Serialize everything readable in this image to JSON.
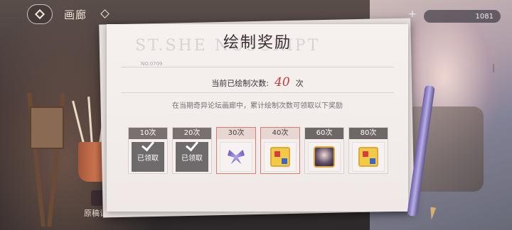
{
  "header": {
    "title": "画廊"
  },
  "currency": {
    "plus": "+",
    "amount": "1081"
  },
  "modal": {
    "title": "绘制奖励",
    "watermark": "ST.SHE    NUSCRIPT",
    "paper_no": "NO.0709",
    "count_label": "当前已绘制次数:",
    "count_value": "40",
    "count_unit": "次",
    "description": "在当期奇异论坛画廊中，累计绘制次数可领取以下奖励"
  },
  "rewards": [
    {
      "label": "10次",
      "state": "claimed",
      "status_text": "已领取",
      "icon": "brush-icon"
    },
    {
      "label": "20次",
      "state": "claimed",
      "status_text": "已领取",
      "icon": "brush-icon"
    },
    {
      "label": "30次",
      "state": "available",
      "icon": "butterfly-icon"
    },
    {
      "label": "40次",
      "state": "available",
      "icon": "palette-icon"
    },
    {
      "label": "60次",
      "state": "locked",
      "icon": "portrait-icon"
    },
    {
      "label": "80次",
      "state": "locked",
      "icon": "palette-icon"
    }
  ],
  "bottom": {
    "label": "原稿记录"
  }
}
